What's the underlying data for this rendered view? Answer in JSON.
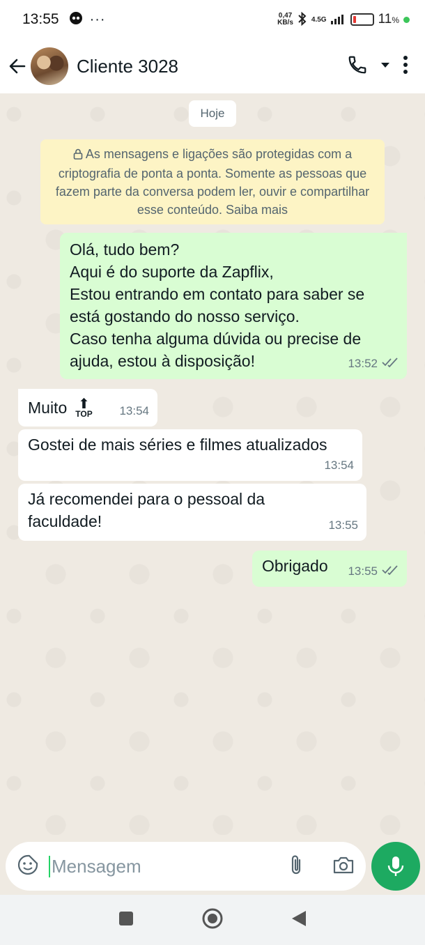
{
  "status_bar": {
    "time": "13:55",
    "net_speed_value": "0,47",
    "net_speed_unit": "KB/s",
    "network": "4.5G",
    "battery_percent": "11",
    "battery_suffix": "%"
  },
  "header": {
    "contact_name": "Cliente 3028"
  },
  "chat": {
    "date_label": "Hoje",
    "encryption_notice": "As mensagens e ligações são protegidas com a criptografia de ponta a ponta. Somente as pessoas que fazem parte da conversa podem ler, ouvir e compartilhar esse conteúdo. Saiba mais",
    "messages": [
      {
        "direction": "outgoing",
        "text": "Olá, tudo bem?\nAqui é do suporte da Zapflix,\nEstou entrando em contato para saber se está gostando do nosso serviço.\nCaso tenha alguma dúvida ou precise de ajuda, estou à disposição!",
        "time": "13:52",
        "status": "delivered"
      },
      {
        "direction": "incoming",
        "text": "Muito",
        "emoji_word": "TOP",
        "time": "13:54"
      },
      {
        "direction": "incoming",
        "text": "Gostei de mais séries e filmes atualizados",
        "time": "13:54"
      },
      {
        "direction": "incoming",
        "text": "Já recomendei para o pessoal da faculdade!",
        "time": "13:55"
      },
      {
        "direction": "outgoing",
        "text": "Obrigado",
        "time": "13:55",
        "status": "delivered"
      }
    ]
  },
  "composer": {
    "placeholder": "Mensagem"
  },
  "colors": {
    "outgoing_bubble": "#d9fdd3",
    "incoming_bubble": "#ffffff",
    "accent_green": "#1daa61",
    "chat_background": "#efeae2"
  },
  "icons": [
    "back-arrow-icon",
    "phone-icon",
    "dropdown-icon",
    "more-vert-icon",
    "lock-icon",
    "double-check-icon",
    "sticker-icon",
    "attach-icon",
    "camera-icon",
    "mic-icon",
    "nav-recents-icon",
    "nav-home-icon",
    "nav-back-icon"
  ]
}
